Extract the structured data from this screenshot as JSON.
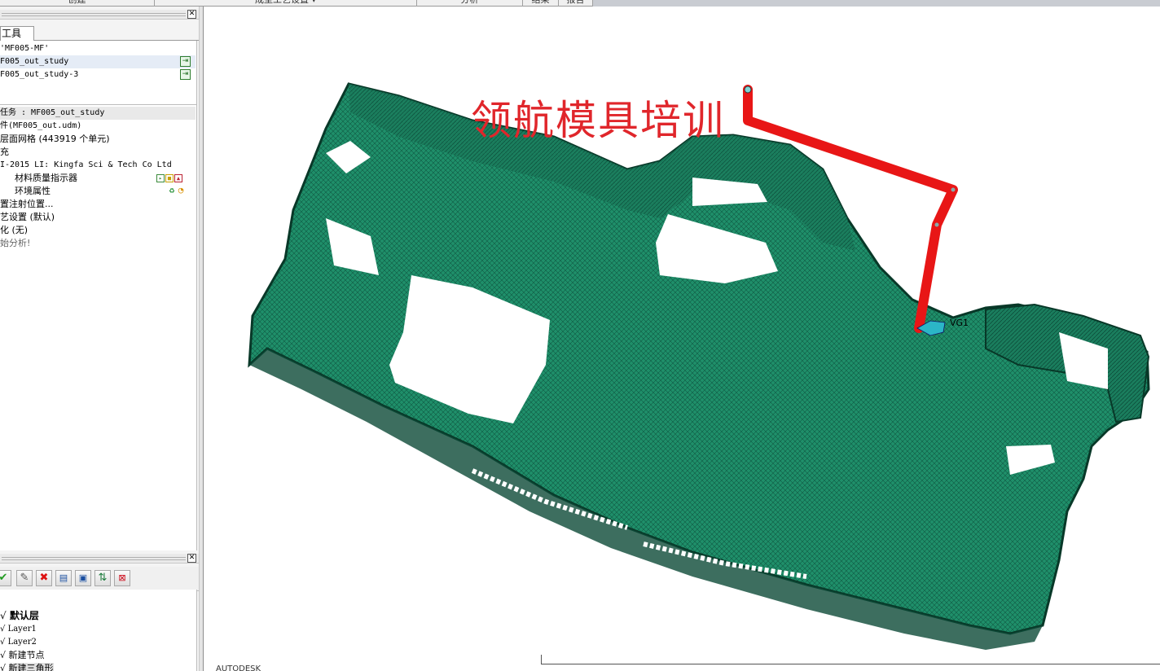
{
  "ribbon": {
    "tabs": [
      "创建",
      "成型工艺设置 ▾",
      "分析",
      "结果",
      "报告"
    ]
  },
  "left_panel": {
    "tab_label": "工具",
    "project_name": "'MF005-MF'",
    "studies": [
      {
        "name": "F005_out_study",
        "selected": true
      },
      {
        "name": "F005_out_study-3",
        "selected": false
      }
    ],
    "task_rows": [
      "任务 : MF005_out_study",
      "件(MF005_out.udm)",
      "层面网格 (443919 个单元)",
      "充",
      "I-2015 LI: Kingfa Sci & Tech Co Ltd",
      "材料质量指示器",
      "环境属性",
      "置注射位置...",
      "艺设置 (默认)",
      "化 (无)",
      "始分析!"
    ]
  },
  "layers": {
    "toolbar_icons": [
      "check-icon",
      "pencil-icon",
      "delete-icon",
      "properties-icon",
      "expand-icon",
      "activate-icon",
      "clear-icon"
    ],
    "items": [
      {
        "label": "默认层",
        "bold": true
      },
      {
        "label": "Layer1",
        "bold": false
      },
      {
        "label": "Layer2",
        "bold": false
      },
      {
        "label": "新建节点",
        "bold": false
      },
      {
        "label": "新建三角形",
        "bold": false,
        "selected": true
      }
    ]
  },
  "viewport": {
    "watermark": "领航模具培训",
    "gate_label": "VG1",
    "brand": "AUTODESK",
    "colors": {
      "mesh": "#1f8f6a",
      "mesh_dark": "#0d4a37",
      "runner": "#e81616",
      "gate": "#2bb6c7",
      "watermark": "#e0262b"
    }
  }
}
